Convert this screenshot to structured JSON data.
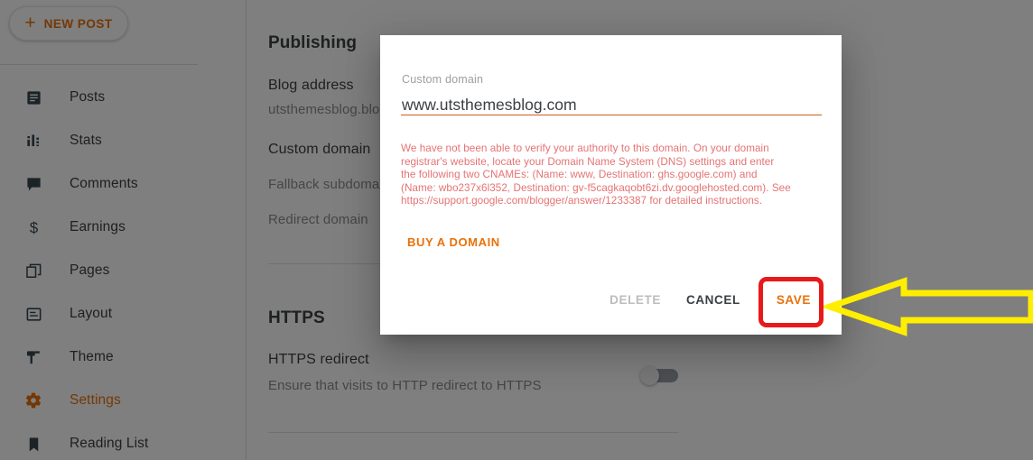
{
  "sidebar": {
    "new_post_button": {
      "label": "NEW POST",
      "icon": "plus-icon"
    },
    "items": [
      {
        "label": "Posts",
        "icon": "posts-icon",
        "active": false
      },
      {
        "label": "Stats",
        "icon": "stats-icon",
        "active": false
      },
      {
        "label": "Comments",
        "icon": "comments-icon",
        "active": false
      },
      {
        "label": "Earnings",
        "icon": "dollar-icon",
        "active": false
      },
      {
        "label": "Pages",
        "icon": "pages-icon",
        "active": false
      },
      {
        "label": "Layout",
        "icon": "layout-icon",
        "active": false
      },
      {
        "label": "Theme",
        "icon": "theme-icon",
        "active": false
      },
      {
        "label": "Settings",
        "icon": "gear-icon",
        "active": true
      },
      {
        "label": "Reading List",
        "icon": "bookmark-icon",
        "active": false
      }
    ]
  },
  "main": {
    "publishing": {
      "section_title": "Publishing",
      "blog_address_label": "Blog address",
      "blog_address_value": "utsthemesblog.blog",
      "custom_domain_label": "Custom domain",
      "fallback_subdomain_label": "Fallback subdomain",
      "redirect_domain_label": "Redirect domain"
    },
    "https": {
      "section_title": "HTTPS",
      "redirect_label": "HTTPS redirect",
      "redirect_description": "Ensure that visits to HTTP redirect to HTTPS",
      "toggle_state": "off"
    }
  },
  "dialog": {
    "field_label": "Custom domain",
    "input_value": "www.utsthemesblog.com",
    "error_message": "We have not been able to verify your authority to this domain. On your domain registrar's website, locate your Domain Name System (DNS) settings and enter the following two CNAMEs: (Name: www, Destination: ghs.google.com) and (Name: wbo237x6l352, Destination: gv-f5cagkaqobt6zi.dv.googlehosted.com). See https://support.google.com/blogger/answer/1233387 for detailed instructions.",
    "buy_domain_label": "BUY A DOMAIN",
    "delete_label": "DELETE",
    "cancel_label": "CANCEL",
    "save_label": "SAVE"
  },
  "annotations": {
    "highlight_target": "save-button",
    "highlight_color": "#e8191b",
    "arrow_color": "#ffee00",
    "arrow_direction": "left"
  },
  "colors": {
    "accent_orange": "#e8710a",
    "error_red": "#e57373",
    "text_primary": "#3c4043",
    "text_muted": "#9e9e9e",
    "scrim": "rgba(0,0,0,0.5)"
  }
}
